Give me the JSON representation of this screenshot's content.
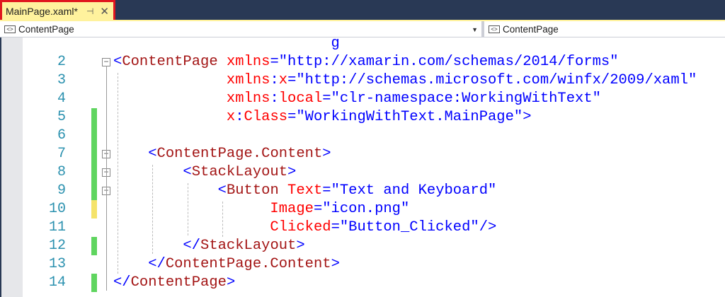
{
  "tab": {
    "title": "MainPage.xaml*",
    "pin_icon": "pin-icon",
    "close_icon": "close-icon"
  },
  "nav": {
    "left": "ContentPage",
    "right": "ContentPage"
  },
  "colors": {
    "added": "#5fd55f",
    "modified": "#f5e36a"
  },
  "lines": [
    {
      "n": "",
      "marker": "",
      "tokens": [
        {
          "t": "                         g",
          "c": "v"
        }
      ]
    },
    {
      "n": "2",
      "marker": "",
      "fold": true,
      "tokens": [
        {
          "t": "<",
          "c": "b"
        },
        {
          "t": "ContentPage",
          "c": "tg"
        },
        {
          "t": " xmlns",
          "c": "at"
        },
        {
          "t": "=\"http://xamarin.com/schemas/2014/forms\"",
          "c": "v"
        }
      ]
    },
    {
      "n": "3",
      "marker": "",
      "tokens": [
        {
          "t": "             xmlns",
          "c": "at"
        },
        {
          "t": ":",
          "c": "b"
        },
        {
          "t": "x",
          "c": "at"
        },
        {
          "t": "=\"http://schemas.microsoft.com/winfx/2009/xaml\"",
          "c": "v"
        }
      ]
    },
    {
      "n": "4",
      "marker": "",
      "tokens": [
        {
          "t": "             xmlns",
          "c": "at"
        },
        {
          "t": ":",
          "c": "b"
        },
        {
          "t": "local",
          "c": "at"
        },
        {
          "t": "=\"clr-namespace:WorkingWithText\"",
          "c": "v"
        }
      ]
    },
    {
      "n": "5",
      "marker": "added",
      "tokens": [
        {
          "t": "             x",
          "c": "at"
        },
        {
          "t": ":",
          "c": "b"
        },
        {
          "t": "Class",
          "c": "at"
        },
        {
          "t": "=\"WorkingWithText.MainPage\">",
          "c": "v"
        }
      ]
    },
    {
      "n": "6",
      "marker": "added",
      "tokens": []
    },
    {
      "n": "7",
      "marker": "added",
      "fold": true,
      "tokens": [
        {
          "t": "    <",
          "c": "b"
        },
        {
          "t": "ContentPage.Content",
          "c": "tg"
        },
        {
          "t": ">",
          "c": "b"
        }
      ]
    },
    {
      "n": "8",
      "marker": "added",
      "fold": true,
      "tokens": [
        {
          "t": "        <",
          "c": "b"
        },
        {
          "t": "StackLayout",
          "c": "tg"
        },
        {
          "t": ">",
          "c": "b"
        }
      ]
    },
    {
      "n": "9",
      "marker": "added",
      "fold": true,
      "tokens": [
        {
          "t": "            <",
          "c": "b"
        },
        {
          "t": "Button",
          "c": "tg"
        },
        {
          "t": " Text",
          "c": "at"
        },
        {
          "t": "=\"Text and Keyboard\"",
          "c": "v"
        }
      ]
    },
    {
      "n": "10",
      "marker": "modified",
      "tokens": [
        {
          "t": "                  Image",
          "c": "at"
        },
        {
          "t": "=\"icon.png\"",
          "c": "v"
        }
      ]
    },
    {
      "n": "11",
      "marker": "",
      "tokens": [
        {
          "t": "                  Clicked",
          "c": "at"
        },
        {
          "t": "=\"Button_Clicked\"/>",
          "c": "v"
        }
      ]
    },
    {
      "n": "12",
      "marker": "added",
      "tokens": [
        {
          "t": "        </",
          "c": "b"
        },
        {
          "t": "StackLayout",
          "c": "tg"
        },
        {
          "t": ">",
          "c": "b"
        }
      ]
    },
    {
      "n": "13",
      "marker": "",
      "tokens": [
        {
          "t": "    </",
          "c": "b"
        },
        {
          "t": "ContentPage.Content",
          "c": "tg"
        },
        {
          "t": ">",
          "c": "b"
        }
      ]
    },
    {
      "n": "14",
      "marker": "added",
      "tokens": [
        {
          "t": "</",
          "c": "b"
        },
        {
          "t": "ContentPage",
          "c": "tg"
        },
        {
          "t": ">",
          "c": "b"
        }
      ]
    }
  ]
}
